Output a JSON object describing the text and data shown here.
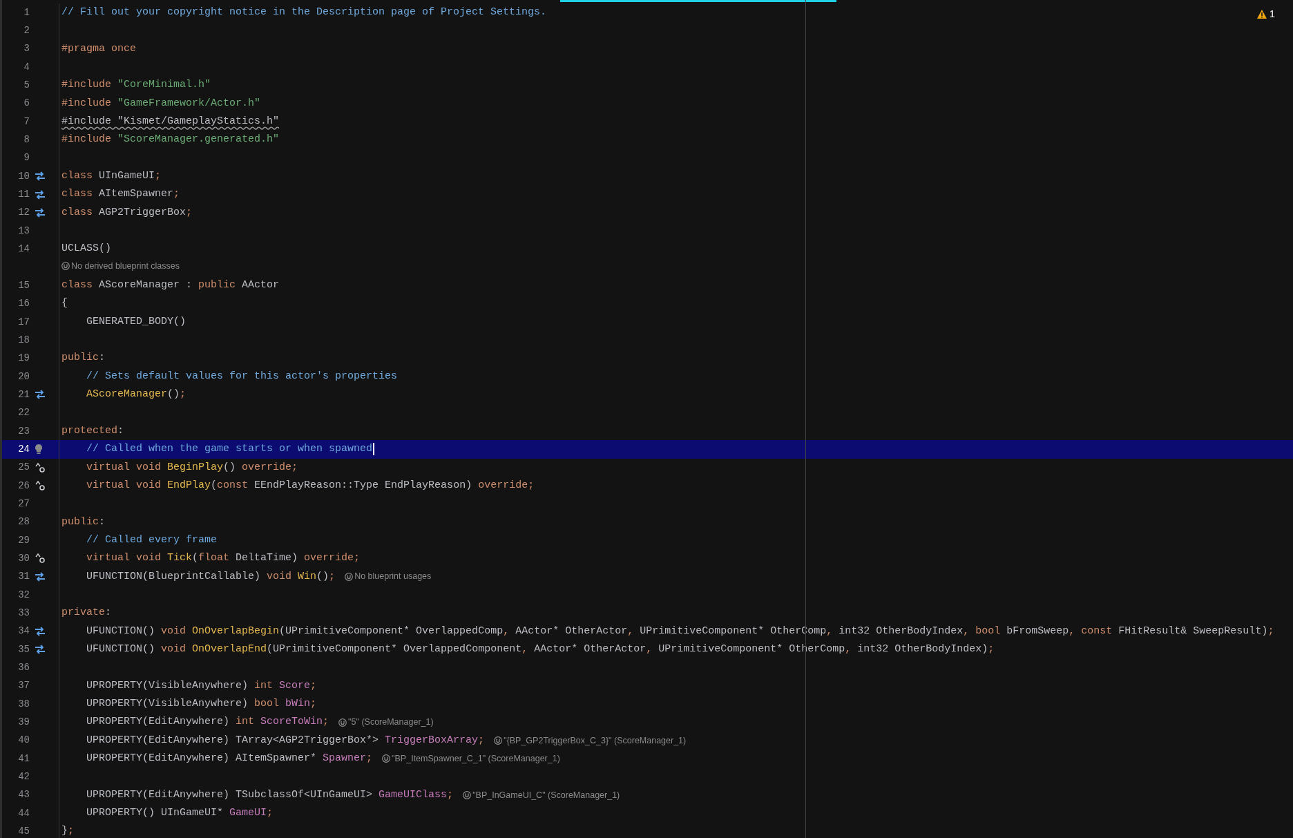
{
  "warnings": {
    "count": "1"
  },
  "lines": [
    {
      "number": "1",
      "selected": false,
      "tokens": [
        {
          "text": "// Fill out your copyright notice in the Description page of Project Settings.",
          "kind": "comment"
        }
      ]
    },
    {
      "number": "2",
      "selected": false
    },
    {
      "number": "3",
      "selected": false,
      "tokens": [
        {
          "text": "#pragma once",
          "kind": "keyword"
        }
      ]
    },
    {
      "number": "4",
      "selected": false
    },
    {
      "number": "5",
      "selected": false,
      "tokens": [
        {
          "text": "#include ",
          "kind": "keyword"
        },
        {
          "text": "\"CoreMinimal.h\"",
          "kind": "string"
        }
      ]
    },
    {
      "number": "6",
      "selected": false,
      "tokens": [
        {
          "text": "#include ",
          "kind": "keyword"
        },
        {
          "text": "\"GameFramework/Actor.h\"",
          "kind": "string"
        }
      ]
    },
    {
      "number": "7",
      "selected": false,
      "tokens": [
        {
          "text": "#include \"Kismet/GameplayStatics.h\"",
          "kind": "unused"
        }
      ]
    },
    {
      "number": "8",
      "selected": false,
      "tokens": [
        {
          "text": "#include ",
          "kind": "keyword"
        },
        {
          "text": "\"ScoreManager.generated.h\"",
          "kind": "string"
        }
      ]
    },
    {
      "number": "9",
      "selected": false
    },
    {
      "number": "10",
      "selected": false,
      "kind": "swap",
      "tokens": [
        {
          "text": "class ",
          "kind": "keyword"
        },
        {
          "text": "UInGameUI",
          "kind": "plain"
        },
        {
          "text": ";",
          "kind": "keyword"
        }
      ]
    },
    {
      "number": "11",
      "selected": false,
      "kind": "swap",
      "tokens": [
        {
          "text": "class ",
          "kind": "keyword"
        },
        {
          "text": "AItemSpawner",
          "kind": "plain"
        },
        {
          "text": ";",
          "kind": "keyword"
        }
      ]
    },
    {
      "number": "12",
      "selected": false,
      "kind": "swap",
      "tokens": [
        {
          "text": "class ",
          "kind": "keyword"
        },
        {
          "text": "AGP2TriggerBox",
          "kind": "plain"
        },
        {
          "text": ";",
          "kind": "keyword"
        }
      ]
    },
    {
      "number": "13",
      "selected": false
    },
    {
      "number": "14",
      "selected": false,
      "tokens": [
        {
          "text": "UCLASS()",
          "kind": "plain"
        }
      ],
      "hint_below": "No derived blueprint classes"
    },
    {
      "number": "15",
      "selected": false,
      "tokens": [
        {
          "text": "class ",
          "kind": "keyword"
        },
        {
          "text": "AScoreManager : ",
          "kind": "plain"
        },
        {
          "text": "public ",
          "kind": "keyword"
        },
        {
          "text": "AActor",
          "kind": "plain"
        }
      ]
    },
    {
      "number": "16",
      "selected": false,
      "tokens": [
        {
          "text": "{",
          "kind": "plain"
        }
      ]
    },
    {
      "number": "17",
      "selected": false,
      "tokens": [
        {
          "text": "    GENERATED_BODY()",
          "kind": "plain"
        }
      ]
    },
    {
      "number": "18",
      "selected": false
    },
    {
      "number": "19",
      "selected": false,
      "tokens": [
        {
          "text": "public",
          "kind": "keyword"
        },
        {
          "text": ":",
          "kind": "plain"
        }
      ]
    },
    {
      "number": "20",
      "selected": false,
      "tokens": [
        {
          "text": "    // Sets default values for this actor's properties",
          "kind": "comment"
        }
      ]
    },
    {
      "number": "21",
      "selected": false,
      "kind": "swap",
      "tokens": [
        {
          "text": "    AScoreManager",
          "kind": "function"
        },
        {
          "text": "()",
          "kind": "plain"
        },
        {
          "text": ";",
          "kind": "keyword"
        }
      ]
    },
    {
      "number": "22",
      "selected": false
    },
    {
      "number": "23",
      "selected": false,
      "tokens": [
        {
          "text": "protected",
          "kind": "keyword"
        },
        {
          "text": ":",
          "kind": "plain"
        }
      ]
    },
    {
      "number": "24",
      "selected": true,
      "kind": "bulb",
      "tokens": [
        {
          "text": "    // Called when the game starts or when spawned",
          "kind": "comment"
        }
      ]
    },
    {
      "number": "25",
      "selected": false,
      "kind": "override",
      "tokens": [
        {
          "text": "    virtual void ",
          "kind": "keyword"
        },
        {
          "text": "BeginPlay",
          "kind": "function"
        },
        {
          "text": "() ",
          "kind": "plain"
        },
        {
          "text": "override;",
          "kind": "keyword"
        }
      ]
    },
    {
      "number": "26",
      "selected": false,
      "kind": "override",
      "tokens": [
        {
          "text": "    virtual void ",
          "kind": "keyword"
        },
        {
          "text": "EndPlay",
          "kind": "function"
        },
        {
          "text": "(",
          "kind": "plain"
        },
        {
          "text": "const ",
          "kind": "keyword"
        },
        {
          "text": "EEndPlayReason::Type EndPlayReason) ",
          "kind": "plain"
        },
        {
          "text": "override;",
          "kind": "keyword"
        }
      ]
    },
    {
      "number": "27",
      "selected": false
    },
    {
      "number": "28",
      "selected": false,
      "tokens": [
        {
          "text": "public",
          "kind": "keyword"
        },
        {
          "text": ":",
          "kind": "plain"
        }
      ]
    },
    {
      "number": "29",
      "selected": false,
      "tokens": [
        {
          "text": "    // Called every frame",
          "kind": "comment"
        }
      ]
    },
    {
      "number": "30",
      "selected": false,
      "kind": "override",
      "tokens": [
        {
          "text": "    virtual void ",
          "kind": "keyword"
        },
        {
          "text": "Tick",
          "kind": "function"
        },
        {
          "text": "(",
          "kind": "plain"
        },
        {
          "text": "float ",
          "kind": "keyword"
        },
        {
          "text": "DeltaTime) ",
          "kind": "plain"
        },
        {
          "text": "override;",
          "kind": "keyword"
        }
      ]
    },
    {
      "number": "31",
      "selected": false,
      "kind": "swap",
      "tokens": [
        {
          "text": "    UFUNCTION(BlueprintCallable) ",
          "kind": "plain"
        },
        {
          "text": "void ",
          "kind": "keyword"
        },
        {
          "text": "Win",
          "kind": "function"
        },
        {
          "text": "()",
          "kind": "plain"
        },
        {
          "text": ";",
          "kind": "keyword"
        }
      ],
      "hint": "No blueprint usages"
    },
    {
      "number": "32",
      "selected": false
    },
    {
      "number": "33",
      "selected": false,
      "tokens": [
        {
          "text": "private",
          "kind": "keyword"
        },
        {
          "text": ":",
          "kind": "plain"
        }
      ]
    },
    {
      "number": "34",
      "selected": false,
      "kind": "swap",
      "tokens": [
        {
          "text": "    UFUNCTION() ",
          "kind": "plain"
        },
        {
          "text": "void ",
          "kind": "keyword"
        },
        {
          "text": "OnOverlapBegin",
          "kind": "function"
        },
        {
          "text": "(UPrimitiveComponent* OverlappedComp",
          "kind": "plain"
        },
        {
          "text": ", ",
          "kind": "keyword"
        },
        {
          "text": "AActor* OtherActor",
          "kind": "plain"
        },
        {
          "text": ", ",
          "kind": "keyword"
        },
        {
          "text": "UPrimitiveComponent* OtherComp",
          "kind": "plain"
        },
        {
          "text": ", ",
          "kind": "keyword"
        },
        {
          "text": "int32 OtherBodyIndex",
          "kind": "plain"
        },
        {
          "text": ", bool ",
          "kind": "keyword"
        },
        {
          "text": "bFromSweep",
          "kind": "plain"
        },
        {
          "text": ", const ",
          "kind": "keyword"
        },
        {
          "text": "FHitResult& SweepResult)",
          "kind": "plain"
        },
        {
          "text": ";",
          "kind": "keyword"
        }
      ]
    },
    {
      "number": "35",
      "selected": false,
      "kind": "swap",
      "tokens": [
        {
          "text": "    UFUNCTION() ",
          "kind": "plain"
        },
        {
          "text": "void ",
          "kind": "keyword"
        },
        {
          "text": "OnOverlapEnd",
          "kind": "function"
        },
        {
          "text": "(UPrimitiveComponent* OverlappedComponent",
          "kind": "plain"
        },
        {
          "text": ", ",
          "kind": "keyword"
        },
        {
          "text": "AActor* OtherActor",
          "kind": "plain"
        },
        {
          "text": ", ",
          "kind": "keyword"
        },
        {
          "text": "UPrimitiveComponent* OtherComp",
          "kind": "plain"
        },
        {
          "text": ", ",
          "kind": "keyword"
        },
        {
          "text": "int32 OtherBodyIndex)",
          "kind": "plain"
        },
        {
          "text": ";",
          "kind": "keyword"
        }
      ]
    },
    {
      "number": "36",
      "selected": false
    },
    {
      "number": "37",
      "selected": false,
      "tokens": [
        {
          "text": "    UPROPERTY(VisibleAnywhere) ",
          "kind": "plain"
        },
        {
          "text": "int ",
          "kind": "keyword"
        },
        {
          "text": "Score",
          "kind": "field"
        },
        {
          "text": ";",
          "kind": "keyword"
        }
      ]
    },
    {
      "number": "38",
      "selected": false,
      "tokens": [
        {
          "text": "    UPROPERTY(VisibleAnywhere) ",
          "kind": "plain"
        },
        {
          "text": "bool ",
          "kind": "keyword"
        },
        {
          "text": "bWin",
          "kind": "field"
        },
        {
          "text": ";",
          "kind": "keyword"
        }
      ]
    },
    {
      "number": "39",
      "selected": false,
      "tokens": [
        {
          "text": "    UPROPERTY(EditAnywhere) ",
          "kind": "plain"
        },
        {
          "text": "int ",
          "kind": "keyword"
        },
        {
          "text": "ScoreToWin",
          "kind": "field"
        },
        {
          "text": ";",
          "kind": "keyword"
        }
      ],
      "hint": "\"5\" (ScoreManager_1)"
    },
    {
      "number": "40",
      "selected": false,
      "tokens": [
        {
          "text": "    UPROPERTY(EditAnywhere) TArray<AGP2TriggerBox*> ",
          "kind": "plain"
        },
        {
          "text": "TriggerBoxArray",
          "kind": "field"
        },
        {
          "text": ";",
          "kind": "keyword"
        }
      ],
      "hint": "\"{BP_GP2TriggerBox_C_3}\" (ScoreManager_1)"
    },
    {
      "number": "41",
      "selected": false,
      "tokens": [
        {
          "text": "    UPROPERTY(EditAnywhere) AItemSpawner* ",
          "kind": "plain"
        },
        {
          "text": "Spawner",
          "kind": "field"
        },
        {
          "text": ";",
          "kind": "keyword"
        }
      ],
      "hint": "\"BP_ItemSpawner_C_1\" (ScoreManager_1)"
    },
    {
      "number": "42",
      "selected": false
    },
    {
      "number": "43",
      "selected": false,
      "tokens": [
        {
          "text": "    UPROPERTY(EditAnywhere) TSubclassOf<UInGameUI> ",
          "kind": "plain"
        },
        {
          "text": "GameUIClass",
          "kind": "field"
        },
        {
          "text": ";",
          "kind": "keyword"
        }
      ],
      "hint": "\"BP_InGameUI_C\" (ScoreManager_1)"
    },
    {
      "number": "44",
      "selected": false,
      "tokens": [
        {
          "text": "    UPROPERTY() UInGameUI* ",
          "kind": "plain"
        },
        {
          "text": "GameUI",
          "kind": "field"
        },
        {
          "text": ";",
          "kind": "keyword"
        }
      ]
    },
    {
      "number": "45",
      "selected": false,
      "tokens": [
        {
          "text": "}",
          "kind": "plain"
        },
        {
          "text": ";",
          "kind": "keyword"
        }
      ]
    }
  ]
}
